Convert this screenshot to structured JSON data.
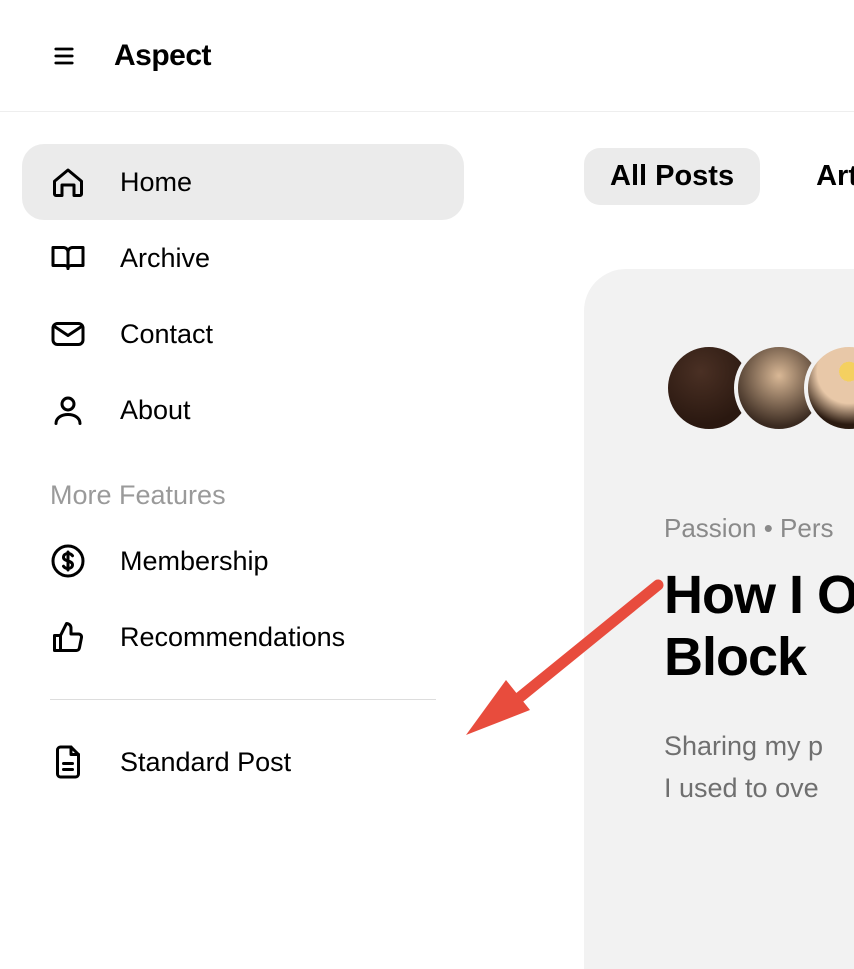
{
  "header": {
    "app_title": "Aspect"
  },
  "sidebar": {
    "items": [
      {
        "label": "Home",
        "icon": "home-icon",
        "active": true
      },
      {
        "label": "Archive",
        "icon": "book-open-icon",
        "active": false
      },
      {
        "label": "Contact",
        "icon": "mail-icon",
        "active": false
      },
      {
        "label": "About",
        "icon": "user-icon",
        "active": false
      }
    ],
    "section_label": "More Features",
    "more_items": [
      {
        "label": "Membership",
        "icon": "dollar-circle-icon"
      },
      {
        "label": "Recommendations",
        "icon": "thumbs-up-icon"
      }
    ],
    "post_type": {
      "label": "Standard Post",
      "icon": "file-text-icon"
    }
  },
  "main": {
    "tabs": [
      {
        "label": "All Posts",
        "active": true
      },
      {
        "label": "Art",
        "active": false
      }
    ],
    "post": {
      "categories_line": "Passion  •  Pers",
      "title_line1": "How I O",
      "title_line2": "Block",
      "excerpt_line1": "Sharing my p",
      "excerpt_line2": "I used to ove"
    }
  },
  "annotation": {
    "arrow_color": "#e84c3d"
  }
}
